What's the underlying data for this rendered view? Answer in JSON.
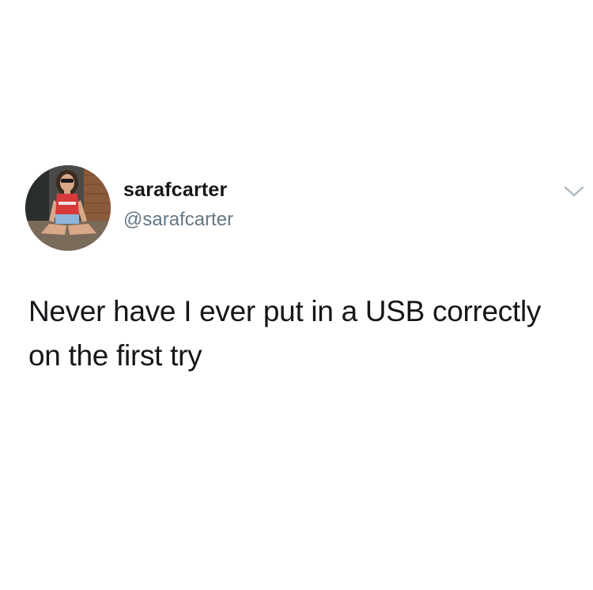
{
  "tweet": {
    "display_name": "sarafcarter",
    "handle": "@sarafcarter",
    "text": "Never have I ever put in a USB correctly on the first try"
  },
  "icons": {
    "more_menu": "chevron-down-icon"
  },
  "colors": {
    "background": "#ffffff",
    "name_text": "#14171a",
    "handle_text": "#657786",
    "chevron": "#aab8c2"
  }
}
